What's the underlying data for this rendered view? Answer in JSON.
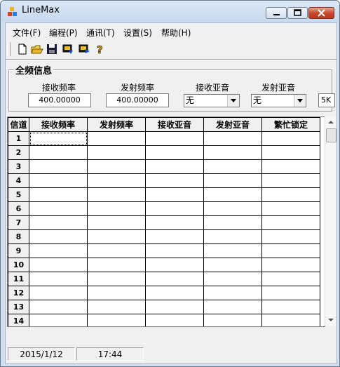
{
  "window": {
    "title": "LineMax"
  },
  "menu": [
    "文件(F)",
    "编程(P)",
    "通讯(T)",
    "设置(S)",
    "帮助(H)"
  ],
  "toolbar": {
    "icons": [
      "new-file-icon",
      "open-folder-icon",
      "save-icon",
      "read-device-icon",
      "write-device-icon",
      "help-icon"
    ],
    "help_glyph": "?"
  },
  "global_panel": {
    "title": "全频信息",
    "rx_freq_label": "接收频率",
    "rx_freq_value": "400.00000",
    "tx_freq_label": "发射频率",
    "tx_freq_value": "400.00000",
    "rx_tone_label": "接收亚音",
    "rx_tone_value": "无",
    "tx_tone_label": "发射亚音",
    "tx_tone_value": "无",
    "step_value": "5K"
  },
  "grid": {
    "headers": [
      "信道",
      "接收频率",
      "发射频率",
      "接收亚音",
      "发射亚音",
      "繁忙锁定"
    ],
    "rows": [
      "1",
      "2",
      "3",
      "4",
      "5",
      "6",
      "7",
      "8",
      "9",
      "10",
      "11",
      "12",
      "13",
      "14"
    ]
  },
  "status": {
    "date": "2015/1/12",
    "time": "17:44"
  }
}
